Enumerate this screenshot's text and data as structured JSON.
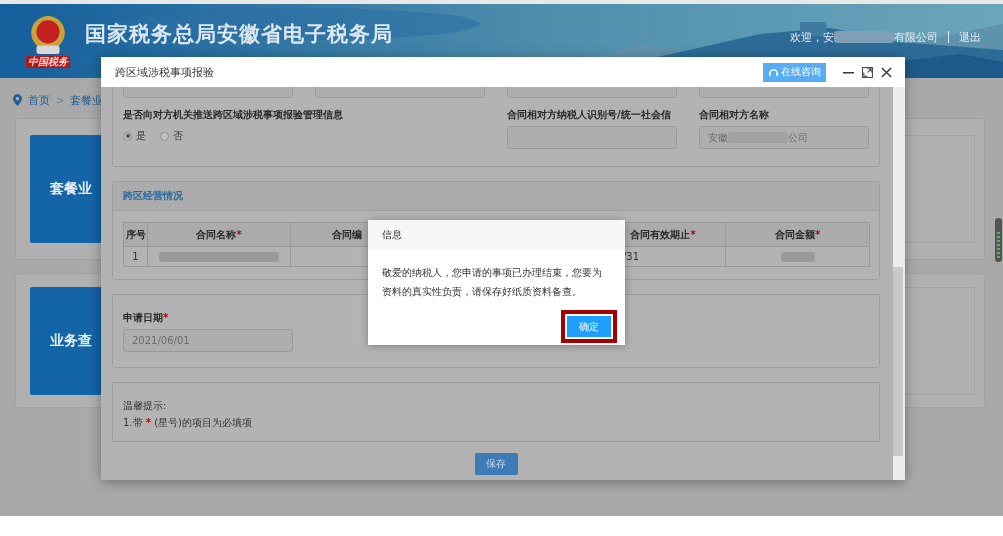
{
  "header": {
    "logo_text": "中国税务",
    "site_title": "国家税务总局安徽省电子税务局",
    "welcome": "欢迎，安",
    "company_suffix": "有限公司",
    "logout": "退出"
  },
  "breadcrumb": {
    "items": [
      {
        "label": "首页"
      },
      {
        "label": "套餐业"
      }
    ],
    "separator": ">"
  },
  "tiles": [
    {
      "label": "套餐业"
    },
    {
      "label": "业务查"
    }
  ],
  "modal": {
    "title": "跨区域涉税事项报验",
    "consult_button": "在线咨询",
    "push_question": {
      "label": "是否向对方机关推送跨区域涉税事项报验管理信息",
      "options": [
        {
          "label": "是",
          "selected": true
        },
        {
          "label": "否",
          "selected": false
        }
      ]
    },
    "fields": [
      {
        "label": "合同相对方纳税人识别号/统一社会信"
      },
      {
        "label": "合同相对方名称",
        "value_prefix": "安徽",
        "value_suffix": "公司",
        "redacted": true
      }
    ],
    "section_title": "跨区经营情况",
    "table": {
      "columns": [
        {
          "label": "序号"
        },
        {
          "label": "合同名称",
          "mark": "*"
        },
        {
          "label": "合同编"
        },
        {
          "label": "合同有效期止",
          "mark": "*"
        },
        {
          "label": "合同金额",
          "mark": "*"
        }
      ],
      "rows": [
        {
          "cells": [
            {
              "kind": "text",
              "text": "1"
            },
            {
              "kind": "redacted"
            },
            {
              "kind": "empty"
            },
            {
              "kind": "text",
              "text": "/31"
            },
            {
              "kind": "redacted"
            }
          ]
        }
      ]
    },
    "date": {
      "label": "申请日期",
      "mark": "*",
      "value": "2021/06/01"
    },
    "tips": {
      "title": "温馨提示:",
      "items": [
        {
          "before": "1.带",
          "mark": "*",
          "after": "(星号)的项目为必填项"
        }
      ]
    },
    "save_button": "保存"
  },
  "dialog": {
    "title": "信息",
    "message": "敬爱的纳税人，您申请的事项已办理结束，您要为资料的真实性负责，请保存好纸质资料备查。",
    "confirm": "确定",
    "confirm_highlighted": true
  }
}
